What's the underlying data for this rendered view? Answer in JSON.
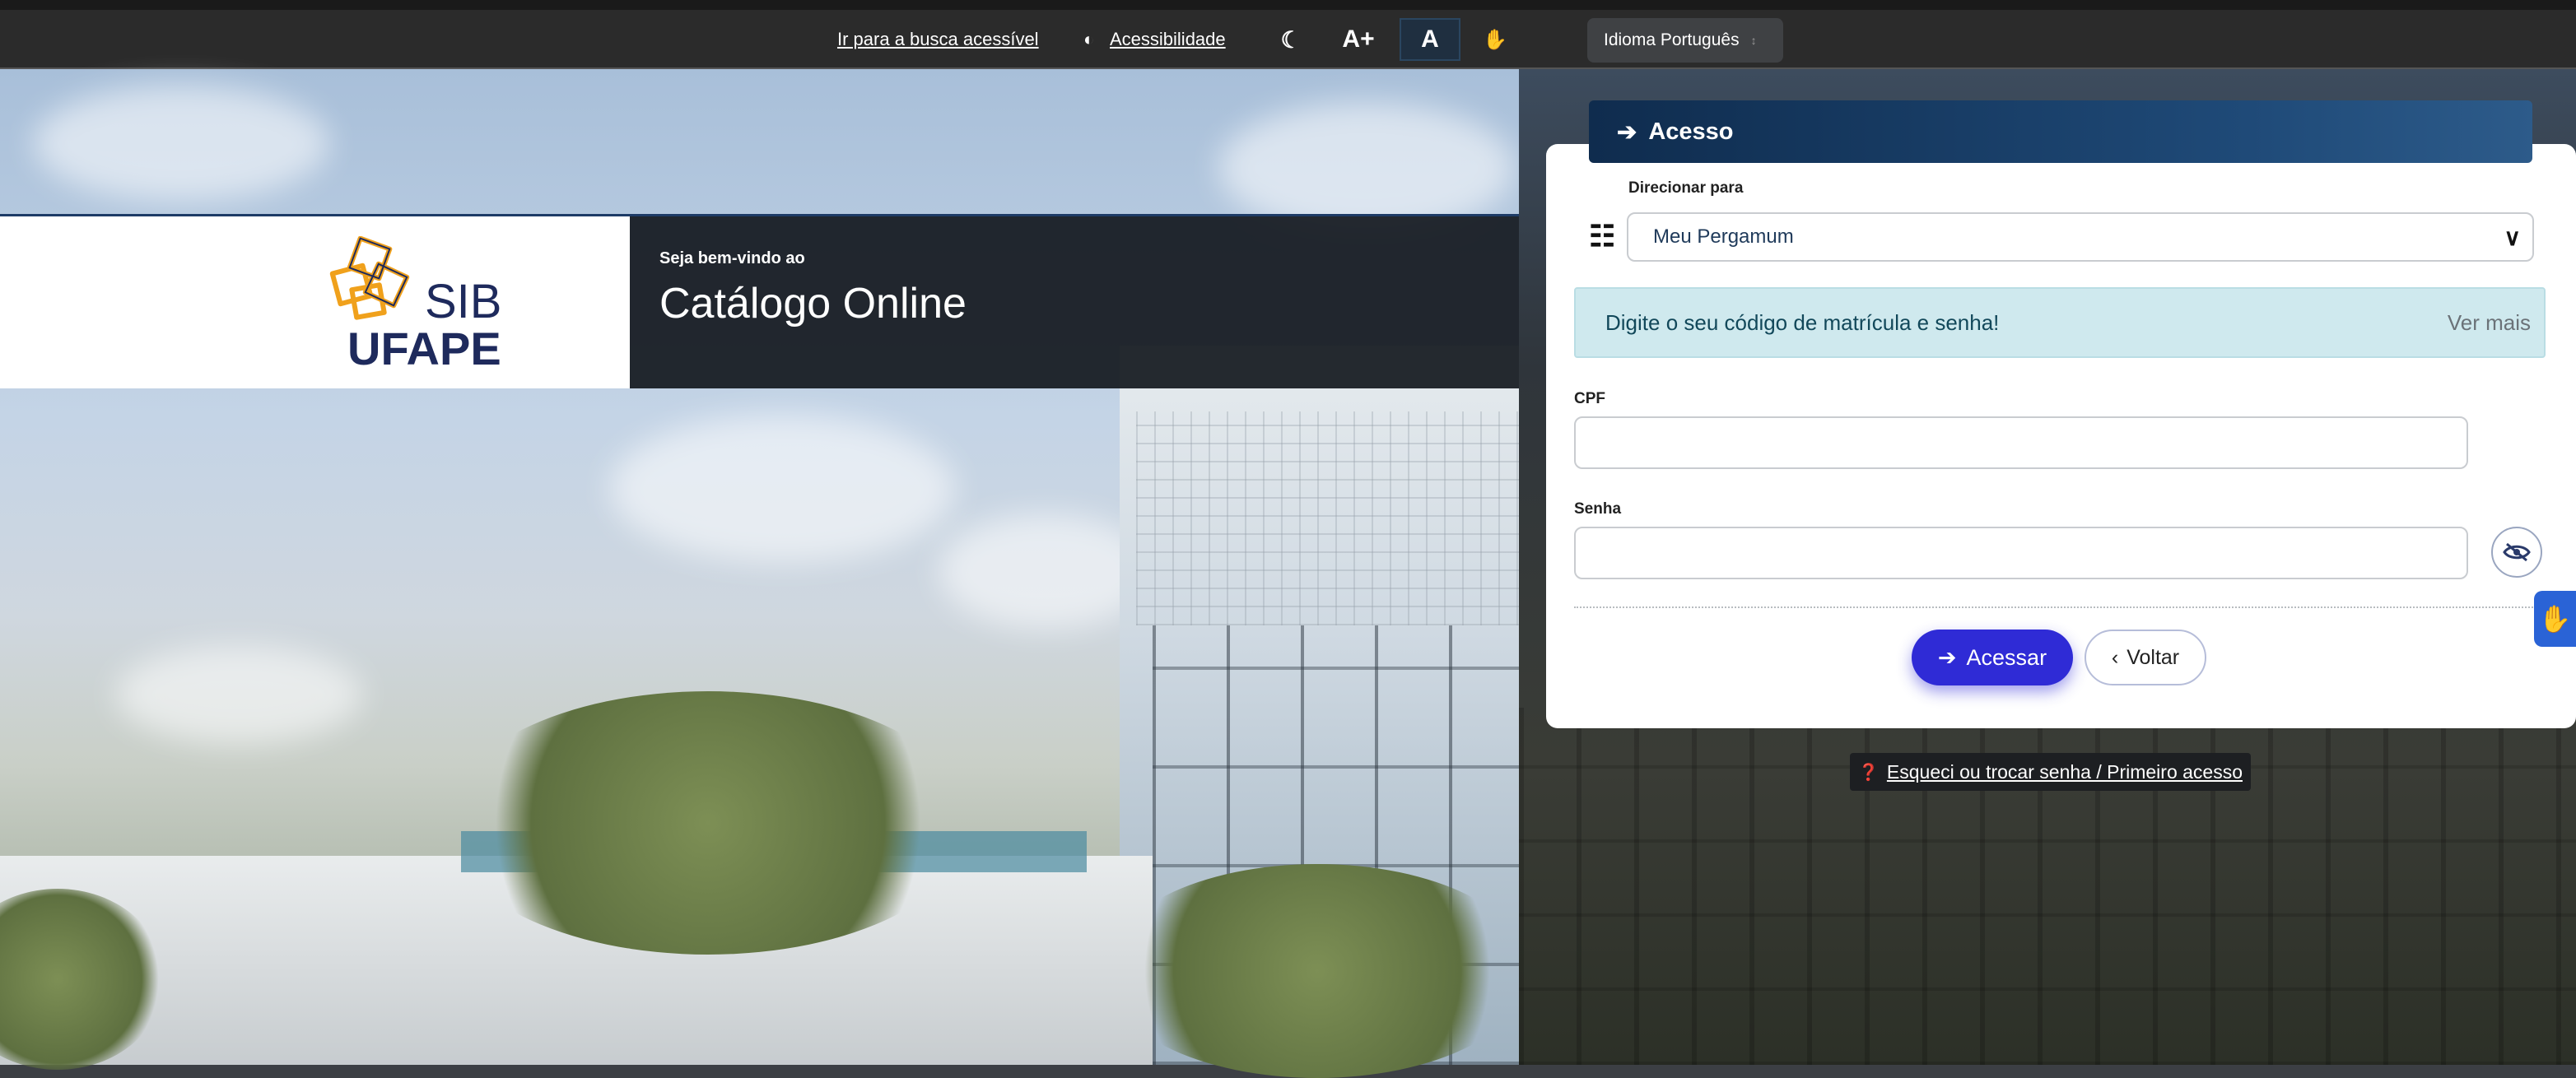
{
  "topbar": {
    "skip_link": "Ir para a busca acessível",
    "accessibility_label": "Acessibilidade",
    "font_increase": "A+",
    "font_normal": "A",
    "language_select": "Idioma Português"
  },
  "banner": {
    "logo_sib": "SIB",
    "logo_ufape": "UFAPE",
    "welcome_small": "Seja bem-vindo ao",
    "welcome_title": "Catálogo Online"
  },
  "login": {
    "header": "Acesso",
    "redirect_label": "Direcionar para",
    "redirect_value": "Meu Pergamum",
    "alert_text": "Digite o seu código de matrícula e senha!",
    "alert_more": "Ver mais",
    "cpf_label": "CPF",
    "cpf_value": "",
    "password_label": "Senha",
    "password_value": "",
    "submit_label": "Acessar",
    "back_label": "Voltar",
    "forgot_link": "Esqueci ou trocar senha / Primeiro acesso"
  },
  "colors": {
    "accent": "#2f2bd6",
    "header_blue": "#0f2c4e",
    "alert_bg": "#cfe9ee",
    "topbar_bg": "#2b2b2b",
    "logo_gold": "#f0a11c",
    "logo_navy": "#1e2a5c"
  },
  "icons": {
    "contrast": "contrast-icon",
    "dark_mode": "moon-icon",
    "sign_language": "hand-icon",
    "signpost": "signpost-icon",
    "login": "sign-in-icon",
    "eye": "eye-slash-icon",
    "back": "chevron-left-icon",
    "help": "question-circle-icon"
  }
}
